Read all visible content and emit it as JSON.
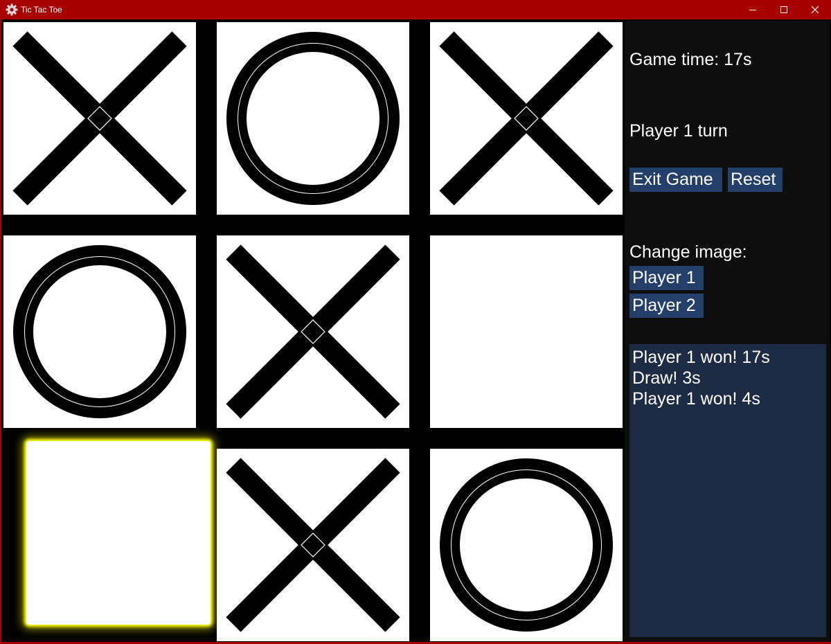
{
  "window": {
    "title": "Tic Tac Toe",
    "icon": "gear-icon",
    "controls": [
      "minimize-icon",
      "maximize-icon",
      "close-icon"
    ],
    "titlebar_color": "#a80000"
  },
  "board": {
    "cells": [
      "X",
      "O",
      "X",
      "O",
      "X",
      "",
      "",
      "X",
      "O"
    ],
    "highlighted_cell": 6,
    "highlight_color": "#ffff00"
  },
  "panel": {
    "game_time": "Game time: 17s",
    "turn": "Player 1 turn",
    "exit_label": "Exit Game",
    "reset_label": "Reset",
    "change_image_label": "Change image:",
    "player1_label": "Player 1",
    "player2_label": "Player 2",
    "history": [
      "Player 1 won! 17s",
      "Draw! 3s",
      "Player 1 won! 4s"
    ]
  }
}
